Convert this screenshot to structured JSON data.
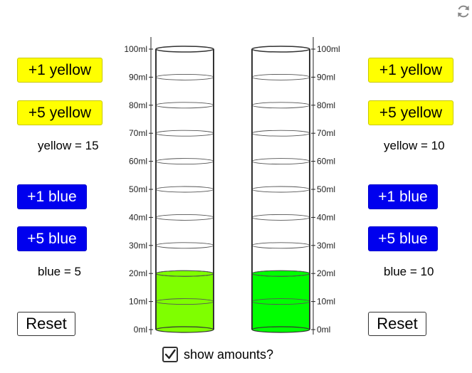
{
  "left": {
    "plus1_yellow": "+1 yellow",
    "plus5_yellow": "+5 yellow",
    "yellow_count": "yellow = 15",
    "plus1_blue": "+1 blue",
    "plus5_blue": "+5 blue",
    "blue_count": "blue = 5",
    "reset": "Reset",
    "fill_ml": 20,
    "liquid_color": "#7fff00"
  },
  "right": {
    "plus1_yellow": "+1 yellow",
    "plus5_yellow": "+5 yellow",
    "yellow_count": "yellow = 10",
    "plus1_blue": "+1 blue",
    "plus5_blue": "+5 blue",
    "blue_count": "blue = 10",
    "reset": "Reset",
    "fill_ml": 20,
    "liquid_color": "#00ff00"
  },
  "scale": {
    "labels": [
      "0ml",
      "10ml",
      "20ml",
      "30ml",
      "40ml",
      "50ml",
      "60ml",
      "70ml",
      "80ml",
      "90ml",
      "100ml"
    ]
  },
  "options": {
    "show_amounts_label": "show amounts?",
    "show_amounts_checked": true
  },
  "icons": {
    "refresh": "refresh-icon",
    "checkmark": "checkmark-icon"
  }
}
